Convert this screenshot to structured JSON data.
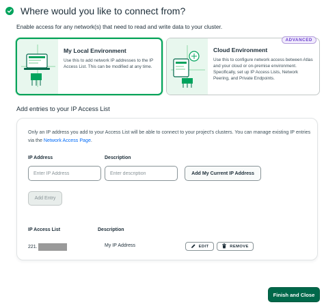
{
  "header": {
    "title": "Where would you like to connect from?",
    "icon": "check-circle-icon"
  },
  "subtitle": "Enable access for any network(s) that need to read and write data to your cluster.",
  "environments": [
    {
      "title": "My Local Environment",
      "description": "Use this to add network IP addresses to the IP Access List. This can be modified at any time.",
      "selected": true
    },
    {
      "title": "Cloud Environment",
      "description": "Use this to configure network access between Atlas and your cloud or on-premise environment. Specifically, set up IP Access Lists, Network Peering, and Private Endpoints.",
      "badge": "ADVANCED",
      "selected": false
    }
  ],
  "ip_section": {
    "title": "Add entries to your IP Access List",
    "description": "Only an IP address you add to your Access List will be able to connect to your project's clusters. You can manage existing IP entries via the",
    "link": "Network Access Page",
    "link_suffix": ".",
    "ip_label": "IP Address",
    "ip_placeholder": "Enter IP Address",
    "desc_label": "Description",
    "desc_placeholder": "Enter description",
    "add_current_ip": "Add My Current IP Address",
    "add_entry": "Add Entry"
  },
  "table": {
    "headers": [
      "IP Access List",
      "Description"
    ],
    "rows": [
      {
        "ip": "221.",
        "description": "My IP Address",
        "edit": "EDIT",
        "remove": "REMOVE"
      }
    ]
  },
  "finish_button": "Finish and Close",
  "colors": {
    "accent": "#00a35c",
    "primary_button": "#00684a",
    "link": "#016bf8",
    "badge": "#6b3fcf"
  }
}
